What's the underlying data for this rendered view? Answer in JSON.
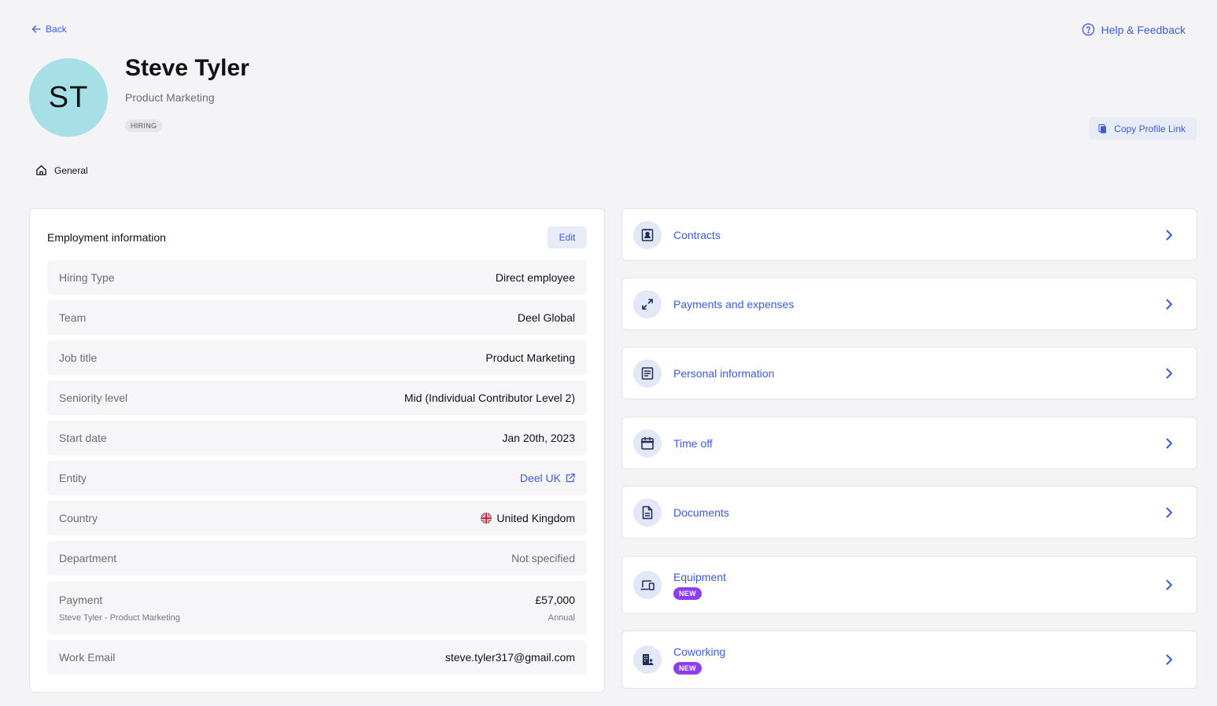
{
  "nav": {
    "back_label": "Back",
    "help_label": "Help & Feedback"
  },
  "profile": {
    "initials": "ST",
    "name": "Steve Tyler",
    "role": "Product Marketing",
    "status": "HIRING",
    "copy_link_label": "Copy Profile Link",
    "avatar_color": "#a6dfe6"
  },
  "tabs": {
    "general": "General"
  },
  "employment": {
    "title": "Employment information",
    "edit_label": "Edit",
    "rows": [
      {
        "label": "Hiring Type",
        "value": "Direct employee"
      },
      {
        "label": "Team",
        "value": "Deel Global"
      },
      {
        "label": "Job title",
        "value": "Product Marketing"
      },
      {
        "label": "Seniority level",
        "value": "Mid (Individual Contributor Level 2)"
      },
      {
        "label": "Start date",
        "value": "Jan 20th, 2023"
      },
      {
        "label": "Entity",
        "value": "Deel UK"
      },
      {
        "label": "Country",
        "value": "United Kingdom"
      },
      {
        "label": "Department",
        "value": "Not specified"
      },
      {
        "label": "Payment",
        "value": "£57,000",
        "sub_label": "Steve Tyler - Product Marketing",
        "sub_value": "Annual"
      },
      {
        "label": "Work Email",
        "value": "steve.tyler317@gmail.com"
      }
    ]
  },
  "sections": [
    {
      "label": "Contracts",
      "icon": "contract-icon"
    },
    {
      "label": "Payments and expenses",
      "icon": "arrows-icon"
    },
    {
      "label": "Personal information",
      "icon": "document-lines-icon"
    },
    {
      "label": "Time off",
      "icon": "calendar-icon"
    },
    {
      "label": "Documents",
      "icon": "file-icon"
    },
    {
      "label": "Equipment",
      "icon": "devices-icon",
      "badge": "NEW"
    },
    {
      "label": "Coworking",
      "icon": "building-icon",
      "badge": "NEW"
    }
  ],
  "colors": {
    "accent": "#3b5bdb",
    "new_badge": "#8b3ff0",
    "background": "#f4f4f6"
  }
}
